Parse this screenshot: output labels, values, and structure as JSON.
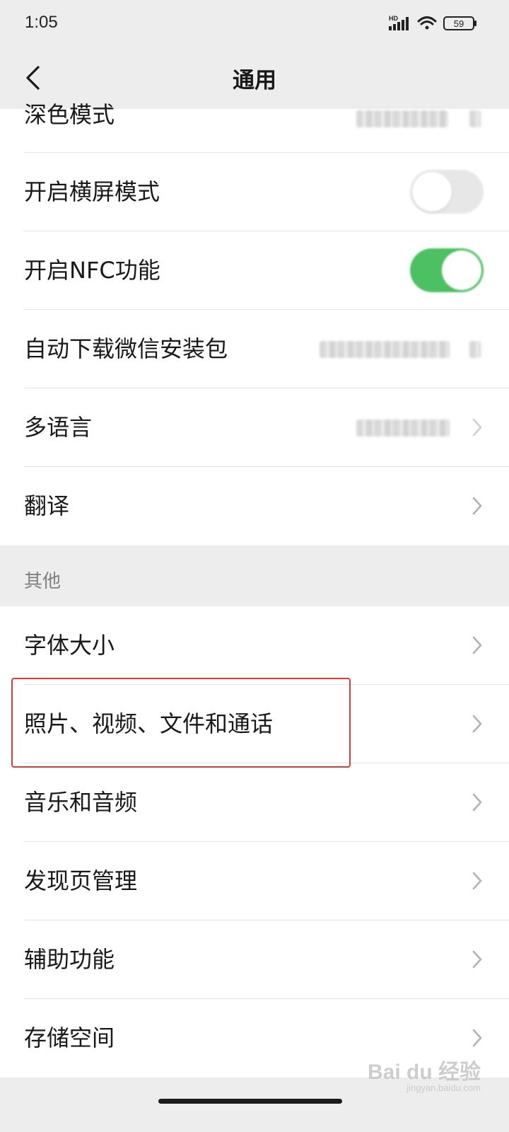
{
  "status_bar": {
    "time": "1:05",
    "network_label": "HD",
    "battery": "59"
  },
  "header": {
    "title": "通用",
    "back_icon": "chevron-left-icon"
  },
  "settings_top": [
    {
      "label": "深色模式",
      "control": "value-chevron"
    },
    {
      "label": "开启横屏模式",
      "control": "toggle",
      "on": false
    },
    {
      "label": "开启NFC功能",
      "control": "toggle",
      "on": true
    },
    {
      "label": "自动下载微信安装包",
      "control": "value-chevron"
    },
    {
      "label": "多语言",
      "control": "value-chevron"
    },
    {
      "label": "翻译",
      "control": "chevron"
    }
  ],
  "section_other": {
    "header": "其他",
    "items": [
      {
        "label": "字体大小"
      },
      {
        "label": "照片、视频、文件和通话"
      },
      {
        "label": "音乐和音频"
      },
      {
        "label": "发现页管理"
      },
      {
        "label": "辅助功能"
      },
      {
        "label": "存储空间"
      }
    ]
  },
  "watermark": {
    "text": "Bai du 经验",
    "subtext": "jingyan.baidu.com"
  },
  "colors": {
    "toggle_on": "#4cc063",
    "toggle_off": "#e5e5e5",
    "highlight": "#e53935"
  }
}
